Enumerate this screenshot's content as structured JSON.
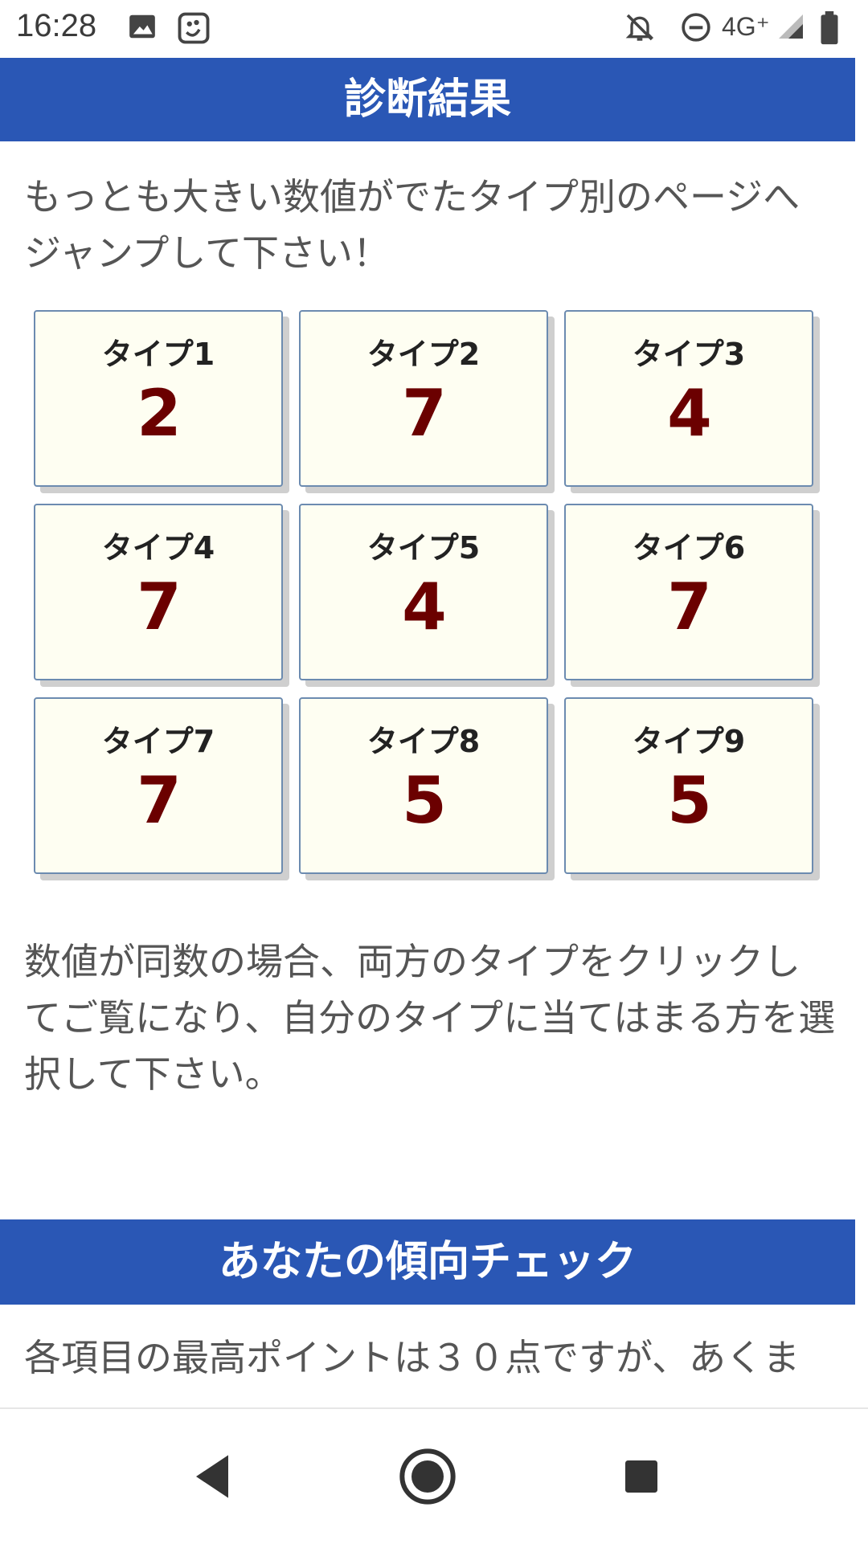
{
  "status_bar": {
    "time": "16:28",
    "network": "4G⁺",
    "icons": [
      "image-icon",
      "app-notification-icon",
      "bell-off-icon",
      "do-not-disturb-icon",
      "signal-icon",
      "battery-icon"
    ]
  },
  "header1": {
    "title": "診断結果"
  },
  "intro": {
    "text": "もっとも大きい数値がでたタイプ別のページへジャンプして下さい！"
  },
  "types": [
    {
      "label": "タイプ1",
      "value": "2"
    },
    {
      "label": "タイプ2",
      "value": "7"
    },
    {
      "label": "タイプ3",
      "value": "4"
    },
    {
      "label": "タイプ4",
      "value": "7"
    },
    {
      "label": "タイプ5",
      "value": "4"
    },
    {
      "label": "タイプ6",
      "value": "7"
    },
    {
      "label": "タイプ7",
      "value": "7"
    },
    {
      "label": "タイプ8",
      "value": "5"
    },
    {
      "label": "タイプ9",
      "value": "5"
    }
  ],
  "note": {
    "text": "数値が同数の場合、両方のタイプをクリックしてご覧になり、自分のタイプに当てはまる方を選択して下さい。"
  },
  "header2": {
    "title": "あなたの傾向チェック"
  },
  "bottom_para": {
    "text": "各項目の最高ポイントは３０点ですが、あくま"
  },
  "nav": {
    "icons": [
      "back-icon",
      "home-icon",
      "recents-icon"
    ]
  },
  "colors": {
    "header_bg": "#2a57b5",
    "card_bg": "#fefef2",
    "card_border": "#6c8bb0",
    "value_color": "#6b0000"
  }
}
